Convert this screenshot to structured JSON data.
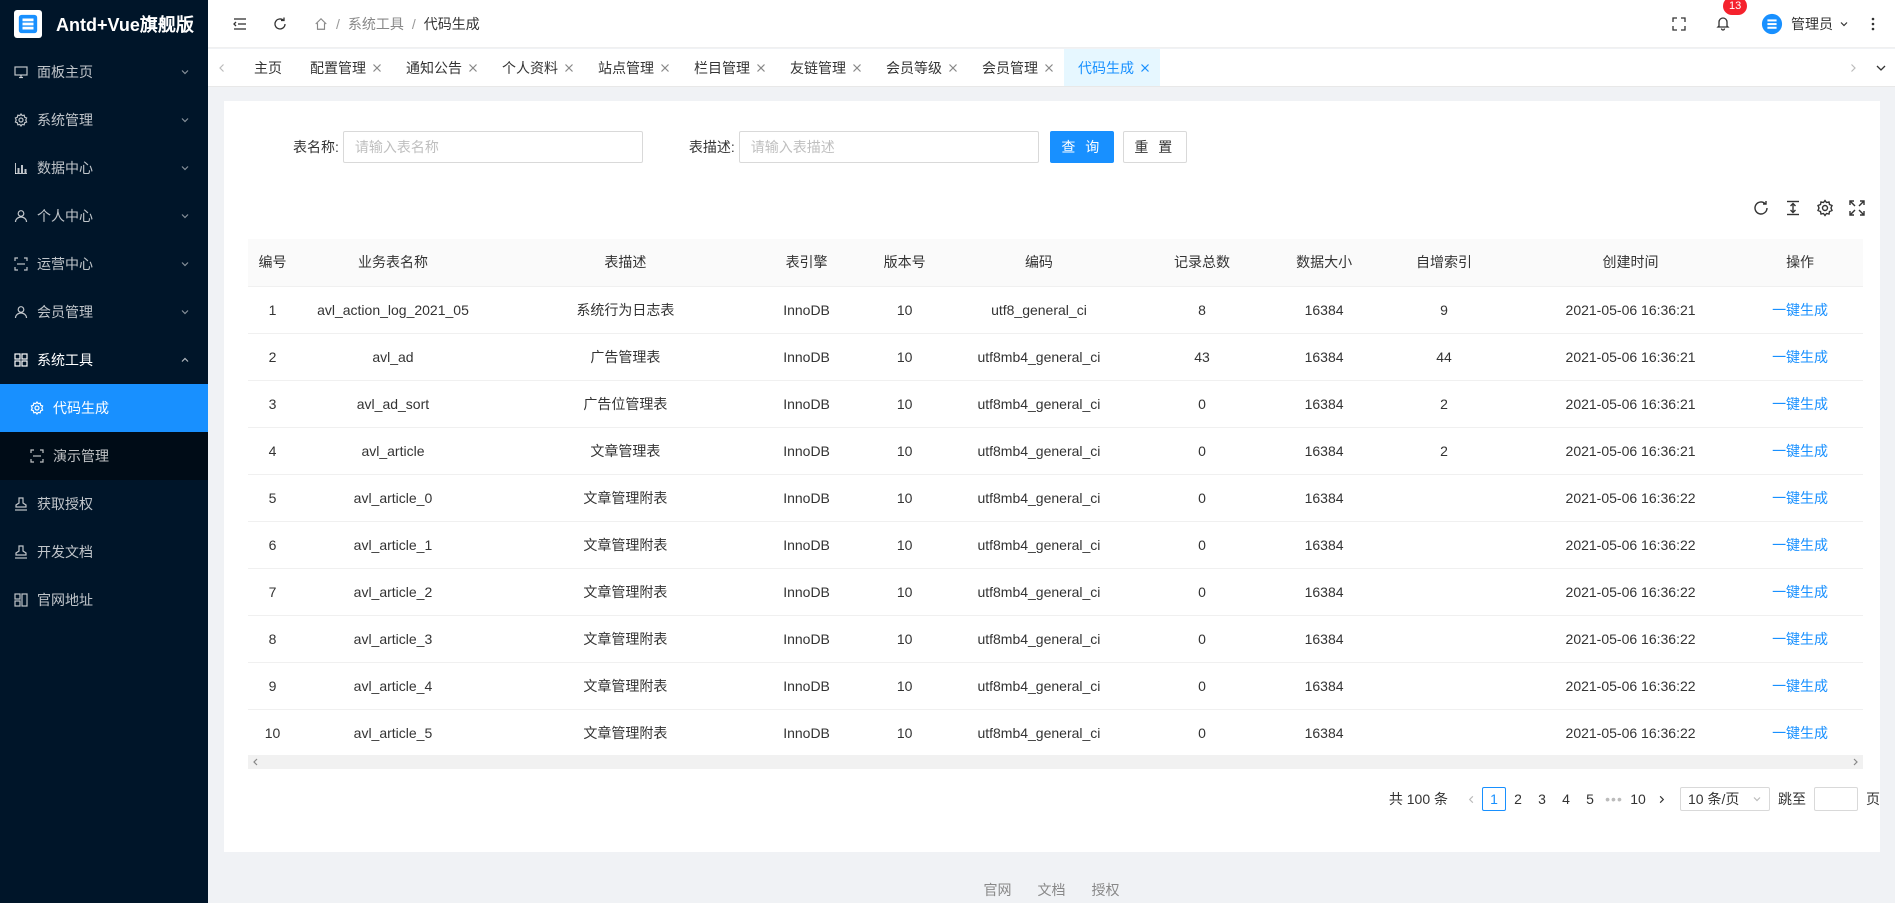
{
  "app": {
    "title": "Antd+Vue旗舰版"
  },
  "sidebar": {
    "items": [
      {
        "label": "面板主页",
        "icon": "monitor-icon",
        "has_arrow": true
      },
      {
        "label": "系统管理",
        "icon": "gear-icon",
        "has_arrow": true
      },
      {
        "label": "数据中心",
        "icon": "chart-icon",
        "has_arrow": true
      },
      {
        "label": "个人中心",
        "icon": "user-icon",
        "has_arrow": true
      },
      {
        "label": "运营中心",
        "icon": "scan-icon",
        "has_arrow": true
      },
      {
        "label": "会员管理",
        "icon": "user-icon",
        "has_arrow": true
      },
      {
        "label": "系统工具",
        "icon": "appstore-icon",
        "has_arrow": true,
        "open": true,
        "children": [
          {
            "label": "代码生成",
            "icon": "gear-icon",
            "active": true
          },
          {
            "label": "演示管理",
            "icon": "scan-icon",
            "active": false
          }
        ]
      },
      {
        "label": "获取授权",
        "icon": "stamp-icon",
        "has_arrow": false
      },
      {
        "label": "开发文档",
        "icon": "stamp-icon",
        "has_arrow": false
      },
      {
        "label": "官网地址",
        "icon": "grid-icon",
        "has_arrow": false
      }
    ]
  },
  "header": {
    "breadcrumb": [
      "系统工具",
      "代码生成"
    ],
    "notification_count": "13",
    "user_name": "管理员"
  },
  "tabs": [
    {
      "label": "主页",
      "closable": false,
      "active": false
    },
    {
      "label": "配置管理",
      "closable": true,
      "active": false
    },
    {
      "label": "通知公告",
      "closable": true,
      "active": false
    },
    {
      "label": "个人资料",
      "closable": true,
      "active": false
    },
    {
      "label": "站点管理",
      "closable": true,
      "active": false
    },
    {
      "label": "栏目管理",
      "closable": true,
      "active": false
    },
    {
      "label": "友链管理",
      "closable": true,
      "active": false
    },
    {
      "label": "会员等级",
      "closable": true,
      "active": false
    },
    {
      "label": "会员管理",
      "closable": true,
      "active": false
    },
    {
      "label": "代码生成",
      "closable": true,
      "active": true
    }
  ],
  "search": {
    "table_name_label": "表名称:",
    "table_name_placeholder": "请输入表名称",
    "table_desc_label": "表描述:",
    "table_desc_placeholder": "请输入表描述",
    "query_label": "查 询",
    "reset_label": "重 置"
  },
  "table": {
    "columns": [
      "编号",
      "业务表名称",
      "表描述",
      "表引擎",
      "版本号",
      "编码",
      "记录总数",
      "数据大小",
      "自增索引",
      "创建时间",
      "操作"
    ],
    "rows": [
      [
        "1",
        "avl_action_log_2021_05",
        "系统行为日志表",
        "InnoDB",
        "10",
        "utf8_general_ci",
        "8",
        "16384",
        "9",
        "2021-05-06 16:36:21",
        "一键生成"
      ],
      [
        "2",
        "avl_ad",
        "广告管理表",
        "InnoDB",
        "10",
        "utf8mb4_general_ci",
        "43",
        "16384",
        "44",
        "2021-05-06 16:36:21",
        "一键生成"
      ],
      [
        "3",
        "avl_ad_sort",
        "广告位管理表",
        "InnoDB",
        "10",
        "utf8mb4_general_ci",
        "0",
        "16384",
        "2",
        "2021-05-06 16:36:21",
        "一键生成"
      ],
      [
        "4",
        "avl_article",
        "文章管理表",
        "InnoDB",
        "10",
        "utf8mb4_general_ci",
        "0",
        "16384",
        "2",
        "2021-05-06 16:36:21",
        "一键生成"
      ],
      [
        "5",
        "avl_article_0",
        "文章管理附表",
        "InnoDB",
        "10",
        "utf8mb4_general_ci",
        "0",
        "16384",
        "",
        "2021-05-06 16:36:22",
        "一键生成"
      ],
      [
        "6",
        "avl_article_1",
        "文章管理附表",
        "InnoDB",
        "10",
        "utf8mb4_general_ci",
        "0",
        "16384",
        "",
        "2021-05-06 16:36:22",
        "一键生成"
      ],
      [
        "7",
        "avl_article_2",
        "文章管理附表",
        "InnoDB",
        "10",
        "utf8mb4_general_ci",
        "0",
        "16384",
        "",
        "2021-05-06 16:36:22",
        "一键生成"
      ],
      [
        "8",
        "avl_article_3",
        "文章管理附表",
        "InnoDB",
        "10",
        "utf8mb4_general_ci",
        "0",
        "16384",
        "",
        "2021-05-06 16:36:22",
        "一键生成"
      ],
      [
        "9",
        "avl_article_4",
        "文章管理附表",
        "InnoDB",
        "10",
        "utf8mb4_general_ci",
        "0",
        "16384",
        "",
        "2021-05-06 16:36:22",
        "一键生成"
      ],
      [
        "10",
        "avl_article_5",
        "文章管理附表",
        "InnoDB",
        "10",
        "utf8mb4_general_ci",
        "0",
        "16384",
        "",
        "2021-05-06 16:36:22",
        "一键生成"
      ]
    ]
  },
  "pagination": {
    "total_text": "共 100 条",
    "pages": [
      "1",
      "2",
      "3",
      "4",
      "5"
    ],
    "current_page": "1",
    "ellipsis": "•••",
    "last_page": "10",
    "page_size": "10 条/页",
    "jump_label": "跳至",
    "jump_suffix": "页"
  },
  "footer": {
    "links": [
      "官网",
      "文档",
      "授权"
    ]
  },
  "colors": {
    "primary": "#1890ff",
    "sidebar_bg": "#001529",
    "submenu_bg": "#000c17",
    "badge": "#f5222d"
  }
}
